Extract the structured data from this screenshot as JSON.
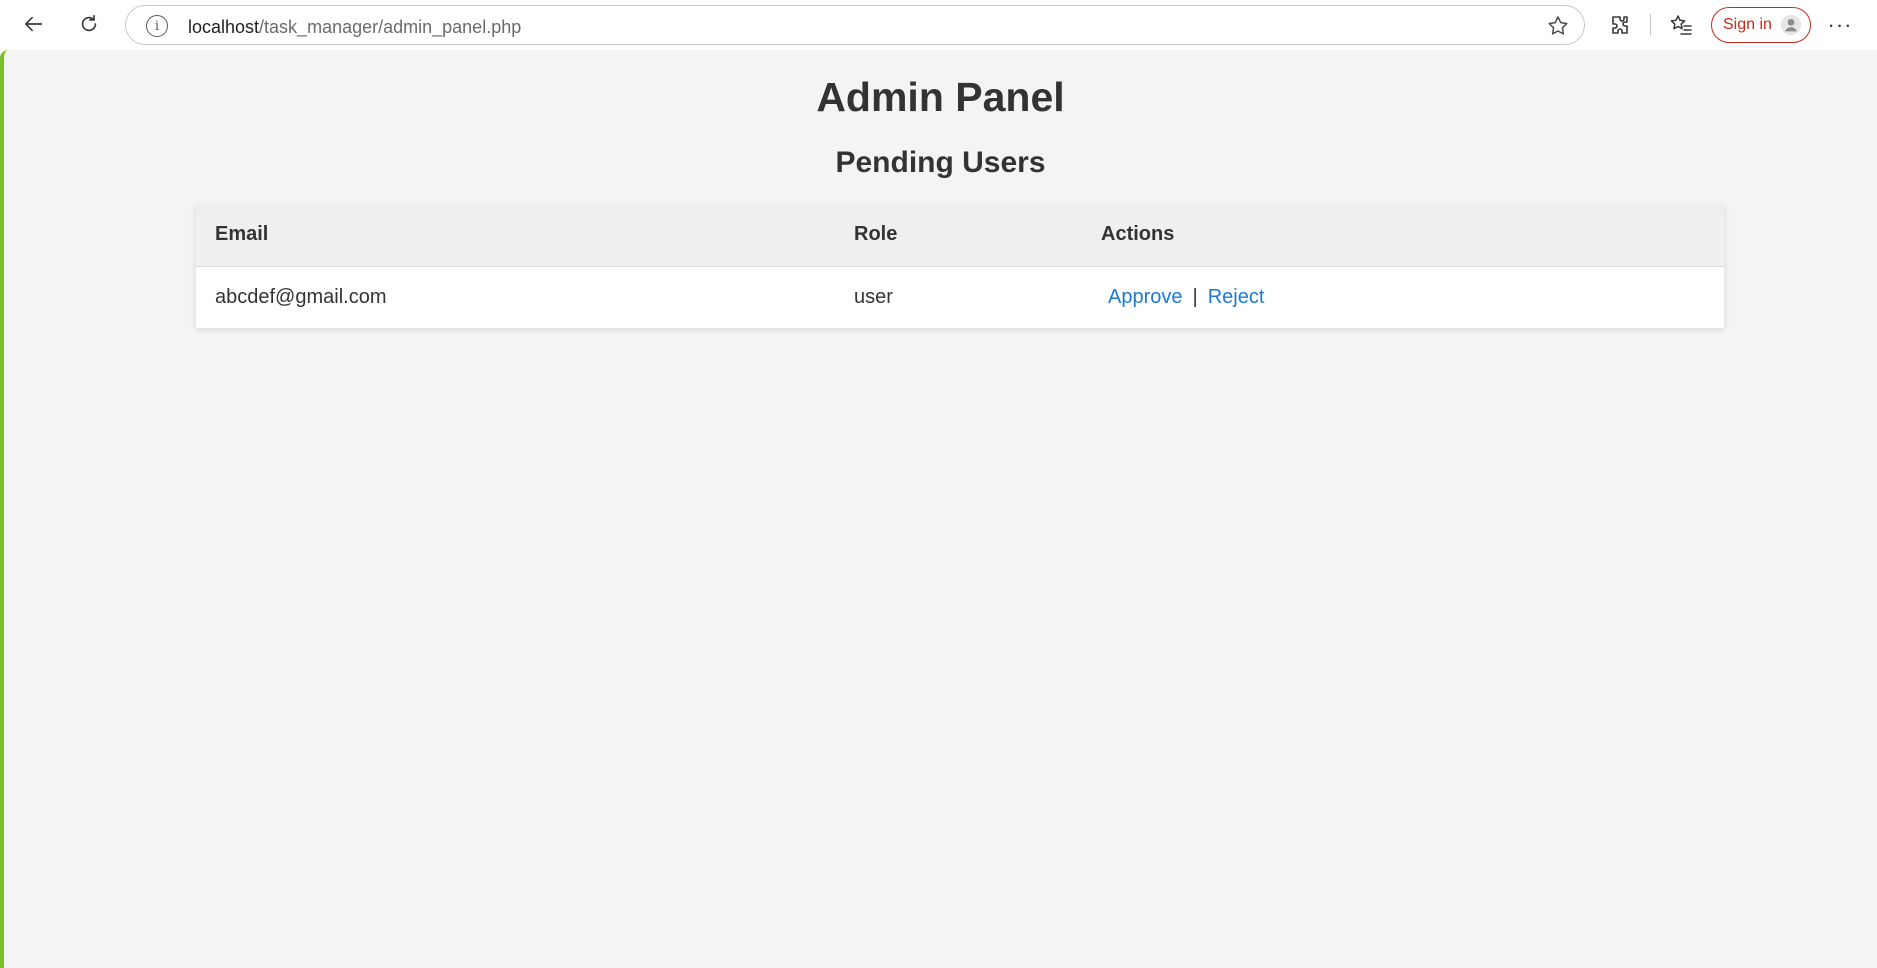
{
  "browser": {
    "url_host": "localhost",
    "url_path": "/task_manager/admin_panel.php",
    "signin_label": "Sign in",
    "more_label": "···",
    "accent_color": "#c42b1c",
    "icons": [
      "back-arrow-icon",
      "refresh-icon",
      "info-icon",
      "star-icon",
      "extensions-icon",
      "favorites-icon",
      "profile-icon",
      "more-icon"
    ]
  },
  "page": {
    "title": "Admin Panel",
    "section_title": "Pending Users"
  },
  "table": {
    "headers": {
      "email": "Email",
      "role": "Role",
      "actions": "Actions"
    },
    "rows": [
      {
        "email": "abcdef@gmail.com",
        "role": "user",
        "approve": "Approve",
        "separator": "|",
        "reject": "Reject"
      }
    ]
  },
  "colors": {
    "link": "#1a7ad6",
    "background": "#f4f4f4",
    "header_bg": "#efefef",
    "text": "#333333"
  }
}
